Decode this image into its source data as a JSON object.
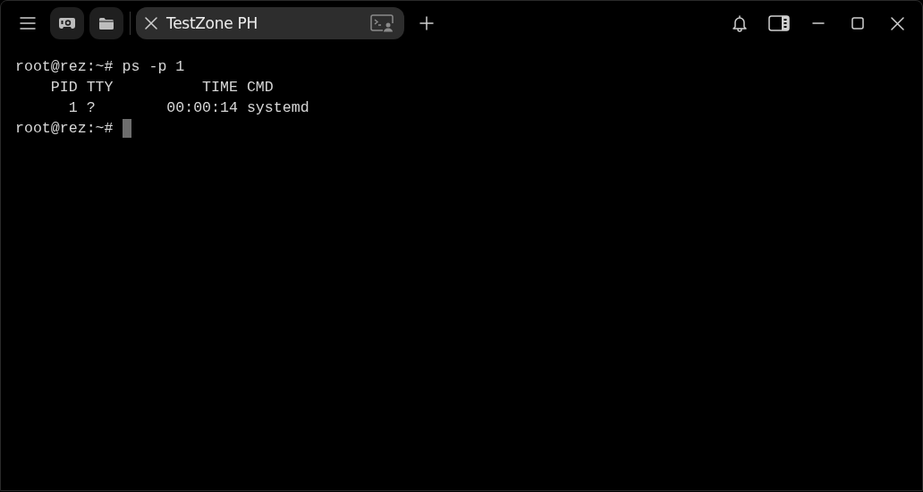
{
  "tabs": [
    {
      "label": "TestZone PH",
      "selected": true
    }
  ],
  "terminal": {
    "lines": [
      {
        "kind": "prompt",
        "prompt": "root@rez:~#",
        "command": "ps -p 1"
      },
      {
        "kind": "output",
        "text": "    PID TTY          TIME CMD"
      },
      {
        "kind": "output",
        "text": "      1 ?        00:00:14 systemd"
      },
      {
        "kind": "prompt",
        "prompt": "root@rez:~#",
        "cursor": true
      }
    ]
  }
}
